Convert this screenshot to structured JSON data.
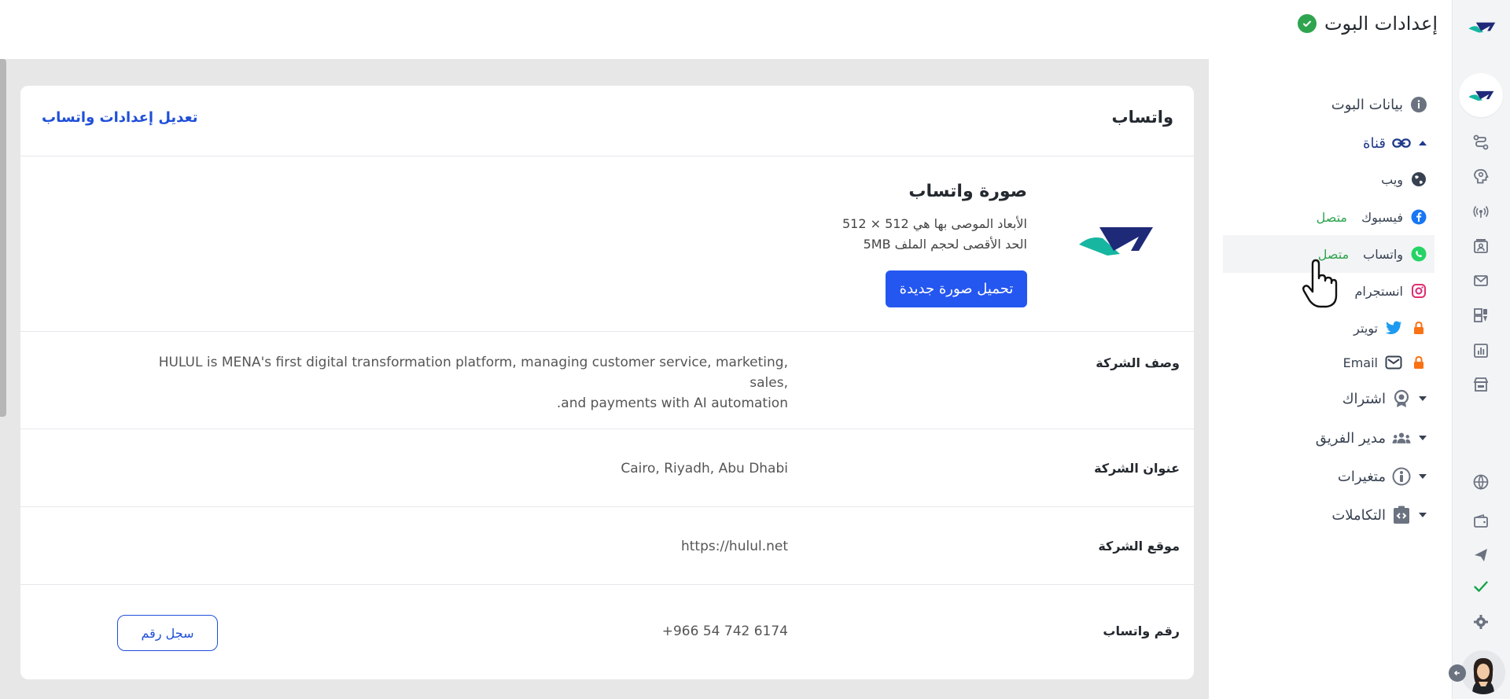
{
  "header": {
    "title": "إعدادات البوت",
    "status": "connected"
  },
  "colors": {
    "accent": "#2456f0",
    "success": "#2ea44f",
    "brand_teal": "#16b6a0",
    "brand_navy": "#1e2a78"
  },
  "sidebar": {
    "bot_data": "بيانات البوت",
    "channel": "قناة",
    "web": "ويب",
    "facebook": "فيسبوك",
    "facebook_status": "متصل",
    "whatsapp": "واتساب",
    "whatsapp_status": "متصل",
    "instagram": "انستجرام",
    "twitter": "تويتر",
    "email": "Email",
    "subscription": "اشتراك",
    "team_manager": "مدير الفريق",
    "variables": "متغيرات",
    "integrations": "التكاملات"
  },
  "card": {
    "title": "واتساب",
    "edit_link": "تعديل إعدادات واتساب",
    "photo_title": "صورة واتساب",
    "photo_dims": "الأبعاد الموصى بها هي 512 × 512",
    "photo_max": "الحد الأقصى لحجم الملف 5MB",
    "upload_button": "تحميل صورة جديدة",
    "rows": {
      "description_label": "وصف الشركة",
      "description_value_line1": "HULUL is MENA's first digital transformation platform, managing customer service, marketing, sales,",
      "description_value_line2": ".and payments with AI automation",
      "address_label": "عنوان الشركة",
      "address_value": "Cairo, Riyadh, Abu Dhabi",
      "website_label": "موقع الشركة",
      "website_value": "https://hulul.net",
      "phone_label": "رقم واتساب",
      "phone_value": "+966 54 742 6174",
      "register_button": "سجل رقم"
    }
  }
}
